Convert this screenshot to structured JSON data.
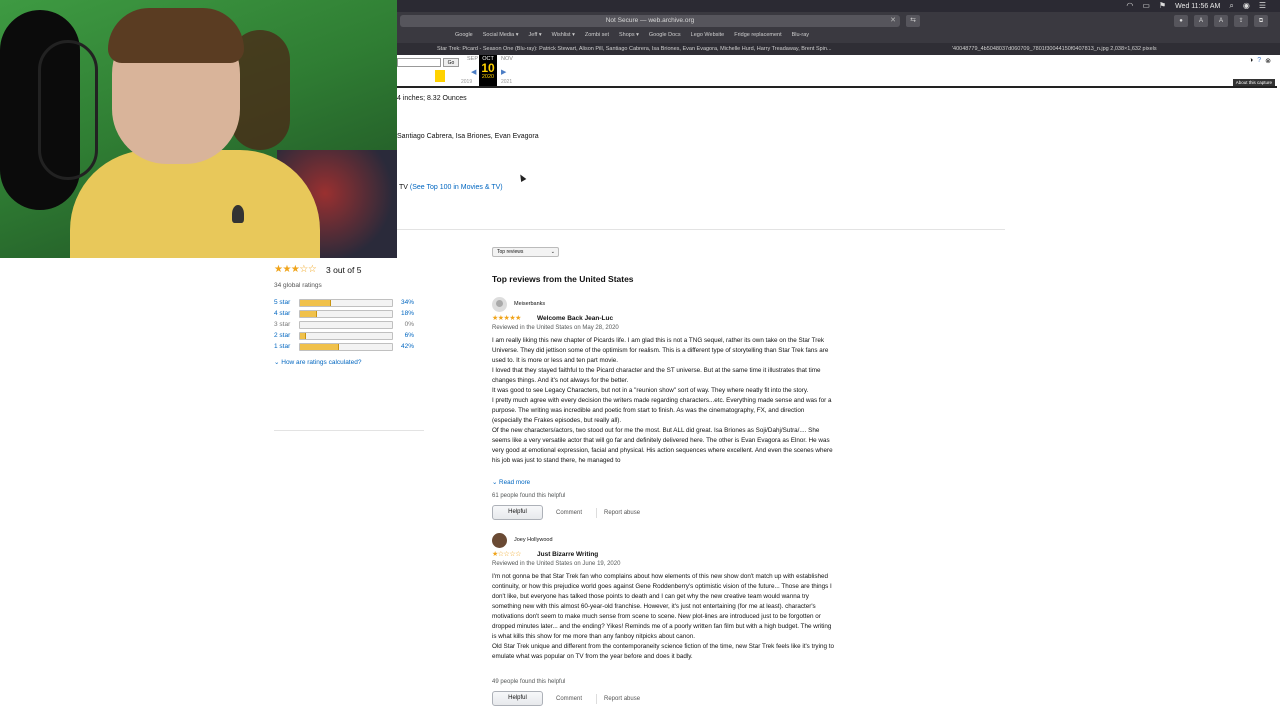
{
  "menubar": {
    "clock": "Wed 11:56 AM"
  },
  "browser": {
    "url_label": "Not Secure — web.archive.org",
    "bookmarks": [
      "Google",
      "Social Media ▾",
      "Jeff ▾",
      "Wishlist ▾",
      "Zombi set",
      "Shops ▾",
      "Google Docs",
      "Lego Website",
      "Fridge replacement",
      "Blu-ray"
    ],
    "active_tab": "Star Trek: Picard - Season One (Blu-ray): Patrick Stewart, Alison Pill, Santiago Cabrera, Isa Briones, Evan Evagora, Michelle Hurd, Harry Treadaway, Brent Spin...",
    "other_tab": "'40048779_4b5048037d060709_7801f30044150f0407813_n.jpg 2,038×1,632 pixels"
  },
  "wayback": {
    "go_label": "Go",
    "month_prev": "SEP",
    "month_current": "OCT",
    "month_next": "NOV",
    "day": "10",
    "year_current": "2020",
    "year_prev": "2019",
    "year_next": "2021",
    "about_label": "About this capture"
  },
  "product_details": {
    "dimensions_fragment": "4 inches; 8.32 Ounces",
    "actors_fragment": "Santiago Cabrera, Isa Briones, Evan Evagora",
    "rank_prefix": "TV",
    "rank_link": "(See Top 100 in Movies & TV)"
  },
  "ratings": {
    "average_stars": "★★★☆☆",
    "out_of": "3 out of 5",
    "global_count": "34 global ratings",
    "histogram": [
      {
        "label": "5 star",
        "percent_label": "34%",
        "percent": 34
      },
      {
        "label": "4 star",
        "percent_label": "18%",
        "percent": 18
      },
      {
        "label": "3 star",
        "percent_label": "0%",
        "percent": 0
      },
      {
        "label": "2 star",
        "percent_label": "6%",
        "percent": 6
      },
      {
        "label": "1 star",
        "percent_label": "42%",
        "percent": 42
      }
    ],
    "how_calculated": "⌄ How are ratings calculated?"
  },
  "reviews_section": {
    "sort_label": "Top reviews",
    "heading": "Top reviews from the United States"
  },
  "reviews": [
    {
      "author": "Meiserbanks",
      "stars": "★★★★★",
      "title": "Welcome Back Jean-Luc",
      "date": "Reviewed in the United States on May 28, 2020",
      "body": [
        "I am really liking this new chapter of Picards life. I am glad this is not a TNG sequel, rather its own take on the Star Trek Universe. They did jettison some of the optimism for realism. This is a different type of storytelling than Star Trek fans are used to. It is more or less and ten part movie.",
        "I loved that they stayed faithful to the Picard character and the ST universe. But at the same time it illustrates that time changes things. And it's not always for the better.",
        "It was good to see Legacy Characters, but not in a \"reunion show\" sort of way. They where neatly fit into the story.",
        "I pretty much agree with every decision the writers made regarding characters...etc. Everything made sense and was for a purpose. The writing was incredible and poetic from start to finish. As was the cinematography, FX, and direction (especially the Frakes episodes, but really all).",
        "Of the new characters/actors, two stood out for me the most. But ALL did great. Isa Briones as Soji/Dahj/Sutra/.... She seems like a very versatile actor that will go far and definitely delivered here. The other is Evan Evagora as Elnor. He was very good at emotional expression, facial and physical. His action sequences where excellent. And even the scenes where his job was just to stand there, he managed to"
      ],
      "read_more": "⌄ Read more",
      "helpful_count": "61 people found this helpful",
      "helpful_label": "Helpful",
      "comment_label": "Comment",
      "report_label": "Report abuse"
    },
    {
      "author": "Joey Hollywood",
      "stars": "★☆☆☆☆",
      "title": "Just Bizarre Writing",
      "date": "Reviewed in the United States on June 19, 2020",
      "body": [
        "I'm not gonna be that Star Trek fan who complains about how elements of this new show don't match up with established continuity, or how this prejudice world goes against Gene Roddenberry's optimistic vision of the future... Those are things I don't like, but everyone has talked those points to death and I can get why the new creative team would wanna try something new with this almost 60-year-old franchise. However, it's just not entertaining (for me at least). character's motivations don't seem to make much sense from scene to scene. New plot-lines are introduced just to be forgotten or dropped minutes later... and the ending? Yikes! Reminds me of a poorly written fan film but with a high budget. The writing is what kills this show for me more than any fanboy nitpicks about canon.",
        "Old Star Trek unique and different from the contemporaneity science fiction of the time, new Star Trek feels like it's trying to emulate what was popular on TV from the year before and does it badly."
      ],
      "helpful_count": "49 people found this helpful",
      "helpful_label": "Helpful",
      "comment_label": "Comment",
      "report_label": "Report abuse"
    }
  ]
}
